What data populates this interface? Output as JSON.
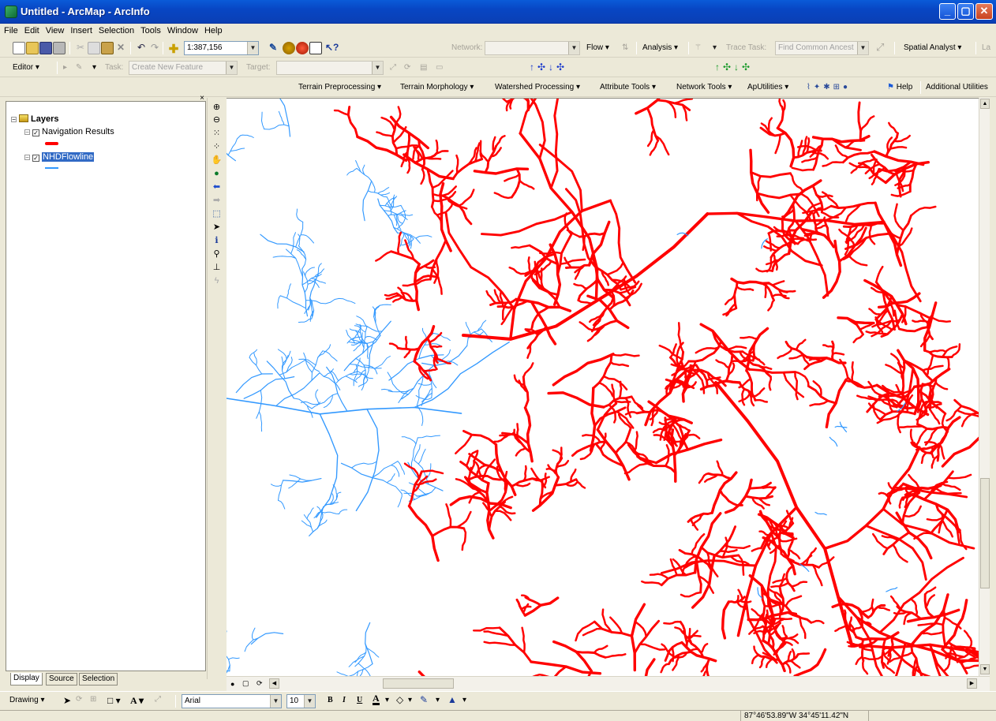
{
  "window": {
    "title": "Untitled - ArcMap - ArcInfo"
  },
  "menu": [
    "File",
    "Edit",
    "View",
    "Insert",
    "Selection",
    "Tools",
    "Window",
    "Help"
  ],
  "standard_toolbar": {
    "scale": "1:387,156"
  },
  "network_toolbar": {
    "network_label": "Network:",
    "flow_label": "Flow",
    "analysis_label": "Analysis",
    "trace_task_label": "Trace Task:",
    "trace_task_value": "Find Common Ancest",
    "spatial_analyst_label": "Spatial Analyst",
    "overflow_label": "La"
  },
  "editor_toolbar": {
    "editor_label": "Editor",
    "task_label": "Task:",
    "task_value": "Create New Feature",
    "target_label": "Target:",
    "target_value": ""
  },
  "hydro_toolbar": {
    "items": [
      "Terrain Preprocessing",
      "Terrain Morphology",
      "Watershed Processing",
      "Attribute Tools",
      "Network Tools",
      "ApUtilities"
    ],
    "help_label": "Help",
    "additional_label": "Additional Utilities"
  },
  "toc": {
    "root": "Layers",
    "layers": [
      {
        "name": "Navigation Results",
        "checked": true,
        "color": "#ff0000"
      },
      {
        "name": "NHDFlowline",
        "checked": true,
        "color": "#3399ff",
        "selected": true
      }
    ],
    "tabs": [
      "Display",
      "Source",
      "Selection"
    ]
  },
  "map": {
    "blue_color": "#3399ff",
    "red_color": "#ff0000"
  },
  "drawing_toolbar": {
    "drawing_label": "Drawing",
    "font": "Arial",
    "size": "10",
    "bold": "B",
    "italic": "I",
    "underline": "U"
  },
  "status": {
    "coordinates": "87°46'53.89\"W  34°45'11.42\"N"
  }
}
